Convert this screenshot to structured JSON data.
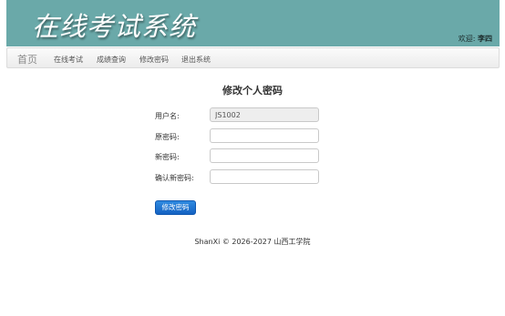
{
  "header": {
    "title": "在线考试系统",
    "welcome_label": "欢迎:",
    "username": "李四",
    "banner_color": "#6aa9a9"
  },
  "navbar": {
    "brand": "首页",
    "items": [
      {
        "label": "在线考试"
      },
      {
        "label": "成绩查询"
      },
      {
        "label": "修改密码"
      },
      {
        "label": "退出系统"
      }
    ]
  },
  "form": {
    "heading": "修改个人密码",
    "username_label": "用户名:",
    "username_value": "JS1002",
    "old_password_label": "原密码:",
    "old_password_value": "",
    "new_password_label": "新密码:",
    "new_password_value": "",
    "confirm_password_label": "确认新密码:",
    "confirm_password_value": "",
    "submit_label": "修改密码",
    "submit_color": "#1a6fd3"
  },
  "footer": {
    "text": "ShanXi © 2026-2027 山西工学院"
  }
}
